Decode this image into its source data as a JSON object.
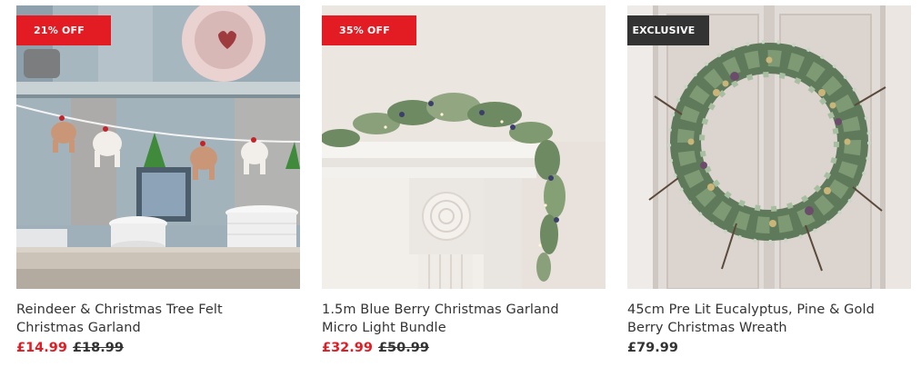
{
  "products": [
    {
      "badge": "21% OFF",
      "title_line1": "Reindeer & Christmas Tree Felt",
      "title_line2": "Christmas Garland",
      "price": "£14.99",
      "was_price": "£18.99"
    },
    {
      "badge": "35% OFF",
      "title_line1": "1.5m Blue Berry Christmas Garland",
      "title_line2": "Micro Light Bundle",
      "price": "£32.99",
      "was_price": "£50.99"
    },
    {
      "badge": "EXCLUSIVE",
      "title_line1": "45cm Pre Lit Eucalyptus, Pine & Gold",
      "title_line2": "Berry Christmas Wreath",
      "price": "£79.99"
    }
  ],
  "colors": {
    "sale_badge": "#e31b23",
    "exclusive_badge": "#333333",
    "sale_price": "#e31b23",
    "text": "#333333"
  }
}
